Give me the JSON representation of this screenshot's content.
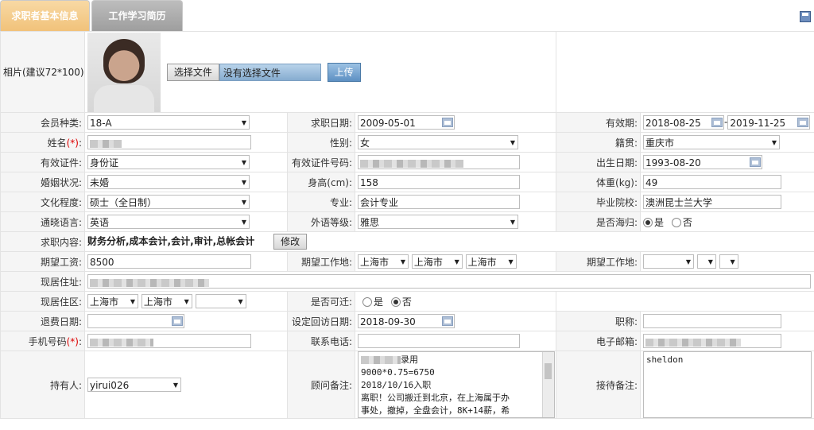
{
  "tabs": [
    {
      "label": "求职者基本信息"
    },
    {
      "label": "工作学习简历"
    }
  ],
  "photo": {
    "label": "相片(建议72*100):",
    "choose_button": "选择文件",
    "file_status": "没有选择文件",
    "upload_button": "上传"
  },
  "row_member": {
    "member_label": "会员种类:",
    "member_value": "18-A",
    "apply_date_label": "求职日期:",
    "apply_date_value": "2009-05-01",
    "valid_label": "有效期:",
    "valid_from": "2018-08-25",
    "valid_sep": "-",
    "valid_to": "2019-11-25"
  },
  "row_name": {
    "name_label": "姓名",
    "name_req": "(*)",
    "name_colon": ":",
    "gender_label": "性别:",
    "gender_value": "女",
    "native_label": "籍贯:",
    "native_value": "重庆市"
  },
  "row_id": {
    "id_type_label": "有效证件:",
    "id_type_value": "身份证",
    "id_no_label": "有效证件号码:",
    "birth_label": "出生日期:",
    "birth_value": "1993-08-20"
  },
  "row_marriage": {
    "marriage_label": "婚姻状况:",
    "marriage_value": "未婚",
    "height_label": "身高(cm):",
    "height_value": "158",
    "weight_label": "体重(kg):",
    "weight_value": "49"
  },
  "row_edu": {
    "edu_label": "文化程度:",
    "edu_value": "硕士（全日制）",
    "major_label": "专业:",
    "major_value": "会计专业",
    "school_label": "毕业院校:",
    "school_value": "澳洲昆士兰大学"
  },
  "row_lang": {
    "lang_label": "通晓语言:",
    "lang_value": "英语",
    "level_label": "外语等级:",
    "level_value": "雅思",
    "overseas_label": "是否海归:",
    "yes": "是",
    "no": "否"
  },
  "row_content": {
    "content_label": "求职内容:",
    "content_value": "财务分析,成本会计,会计,审计,总帐会计",
    "modify_button": "修改"
  },
  "row_salary": {
    "salary_label": "期望工资:",
    "salary_value": "8500",
    "place1_label": "期望工作地:",
    "place1_a": "上海市",
    "place1_b": "上海市",
    "place1_c": "上海市",
    "place2_label": "期望工作地:"
  },
  "row_address": {
    "address_label": "现居住址:"
  },
  "row_area": {
    "area_label": "现居住区:",
    "area_a": "上海市",
    "area_b": "上海市",
    "move_label": "是否可迁:",
    "yes": "是",
    "no": "否"
  },
  "row_refund": {
    "refund_label": "退费日期:",
    "callback_label": "设定回访日期:",
    "callback_value": "2018-09-30",
    "title_label": "职称:"
  },
  "row_phone": {
    "mobile_label": "手机号码",
    "mobile_req": "(*)",
    "mobile_colon": ":",
    "tel_label": "联系电话:",
    "email_label": "电子邮箱:"
  },
  "row_notes": {
    "holder_label": "持有人:",
    "holder_value": "yirui026",
    "advisor_label": "顾问备注:",
    "advisor_line1": "录用",
    "advisor_line2": "9000*0.75=6750",
    "advisor_line3": "2018/10/16入职",
    "advisor_line4": "离职！公司搬迁到北京，在上海属于办",
    "advisor_line5": "事处，撤掉，全盘会计，8K+14薪，希",
    "reception_label": "接待备注:",
    "reception_value": "sheldon"
  }
}
